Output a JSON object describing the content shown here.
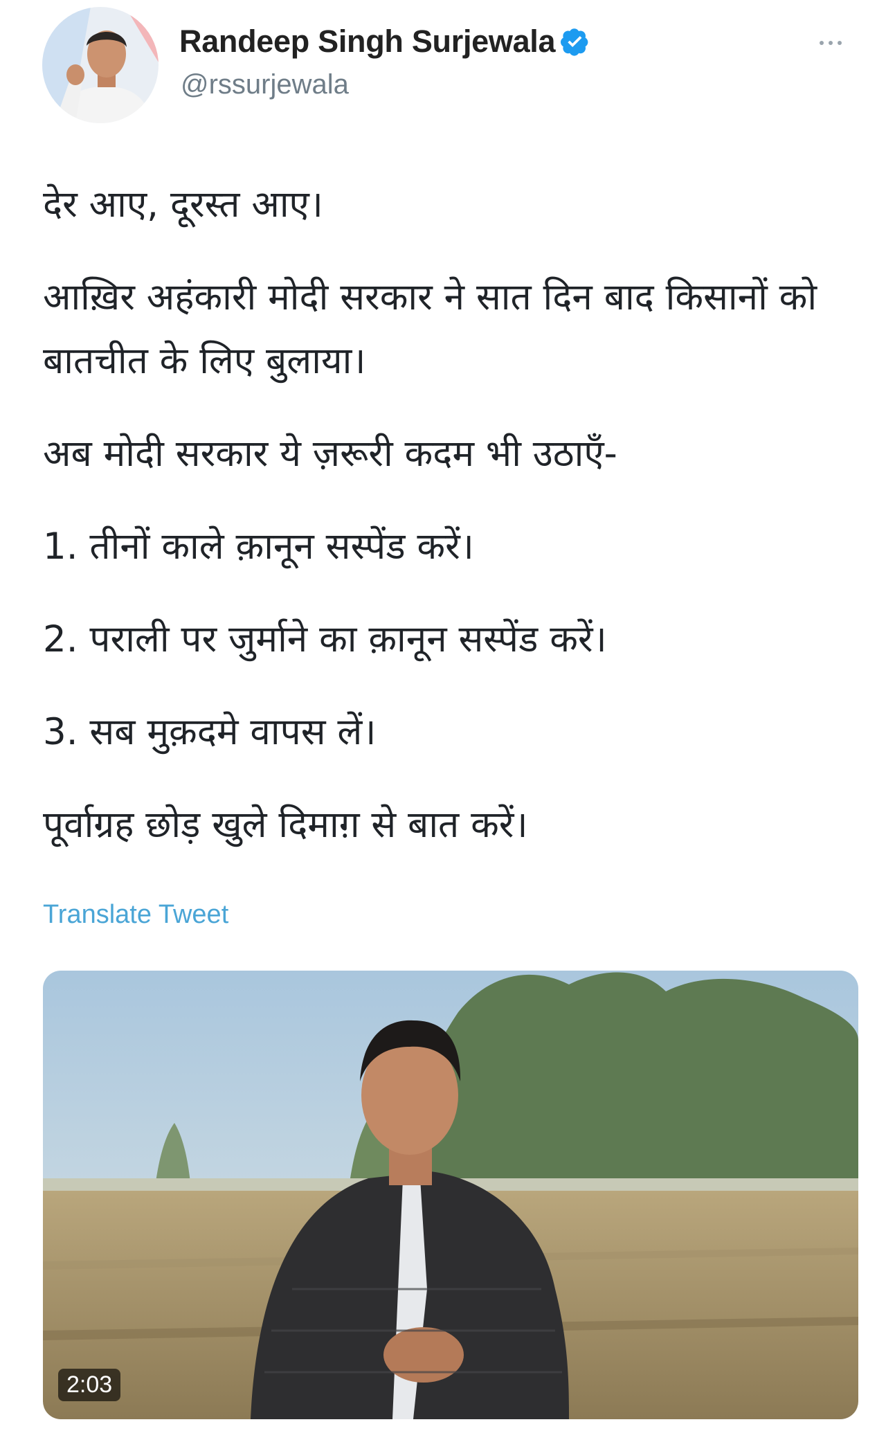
{
  "tweet": {
    "author": {
      "display_name": "Randeep Singh Surjewala",
      "handle": "@rssurjewala",
      "verified": true
    },
    "text_paragraphs": [
      "देर आए, दूरस्त आए।",
      "आख़िर अहंकारी मोदी सरकार ने सात दिन बाद किसानों को बातचीत के लिए बुलाया।",
      "अब मोदी सरकार ये ज़रूरी कदम भी उठाएँ-",
      "1. तीनों काले क़ानून सस्पेंड करें।",
      "2. पराली पर जुर्माने का क़ानून सस्पेंड करें।",
      "3. सब मुक़दमे वापस लें।",
      "पूर्वाग्रह छोड़ खुले दिमाग़ से बात करें।"
    ],
    "translate_label": "Translate Tweet",
    "video": {
      "duration": "2:03"
    }
  },
  "icons": {
    "verified": "verified-badge-icon",
    "more": "more-options-icon"
  },
  "colors": {
    "verified_blue": "#1d9bf0",
    "link_blue": "#4aa5d6",
    "handle_gray": "#6f7d88"
  }
}
